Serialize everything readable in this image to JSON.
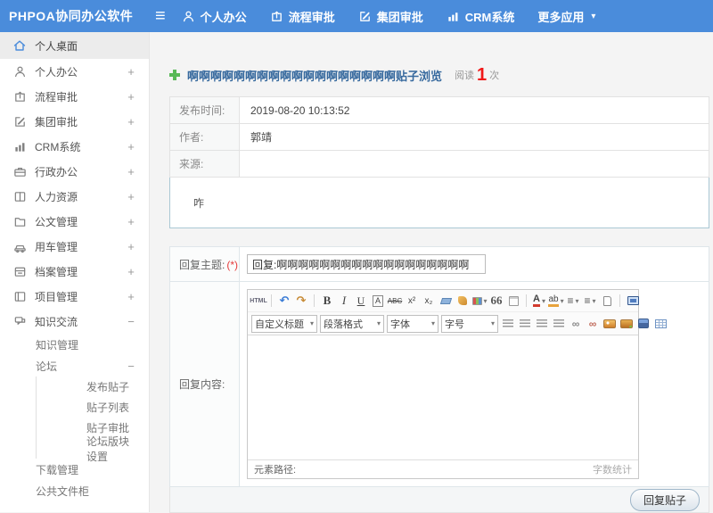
{
  "colors": {
    "accent_blue": "#4a8cdb",
    "title_blue": "#36699e",
    "alert_red": "#f01818",
    "plus_green": "#58b957"
  },
  "navbar": {
    "logo": "PHPOA协同办公软件",
    "items": [
      {
        "label": "个人办公",
        "icon": "user-icon"
      },
      {
        "label": "流程审批",
        "icon": "workflow-icon"
      },
      {
        "label": "集团审批",
        "icon": "edit-square-icon"
      },
      {
        "label": "CRM系统",
        "icon": "bar-chart-icon"
      },
      {
        "label": "更多应用",
        "icon": "caret-down-icon"
      }
    ],
    "caret": "▾",
    "hamburger": "≡"
  },
  "sidebar": {
    "items": [
      {
        "label": "个人桌面",
        "icon": "home-icon",
        "level": 0,
        "selected": true,
        "expander": ""
      },
      {
        "label": "个人办公",
        "icon": "user-icon",
        "level": 0,
        "expander": "+"
      },
      {
        "label": "流程审批",
        "icon": "workflow-icon",
        "level": 0,
        "expander": "+"
      },
      {
        "label": "集团审批",
        "icon": "edit-square-icon",
        "level": 0,
        "expander": "+"
      },
      {
        "label": "CRM系统",
        "icon": "bar-chart-icon",
        "level": 0,
        "expander": "+"
      },
      {
        "label": "行政办公",
        "icon": "briefcase-icon",
        "level": 0,
        "expander": "+"
      },
      {
        "label": "人力资源",
        "icon": "book-icon",
        "level": 0,
        "expander": "+"
      },
      {
        "label": "公文管理",
        "icon": "folder-icon",
        "level": 0,
        "expander": "+"
      },
      {
        "label": "用车管理",
        "icon": "car-icon",
        "level": 0,
        "expander": "+"
      },
      {
        "label": "档案管理",
        "icon": "archive-icon",
        "level": 0,
        "expander": "+"
      },
      {
        "label": "项目管理",
        "icon": "project-icon",
        "level": 0,
        "expander": "+"
      },
      {
        "label": "知识交流",
        "icon": "chat-icon",
        "level": 0,
        "expander": "−"
      },
      {
        "label": "知识管理",
        "level": 1,
        "expander": ""
      },
      {
        "label": "论坛",
        "level": 1,
        "expander": "−"
      },
      {
        "label": "发布贴子",
        "level": 2
      },
      {
        "label": "贴子列表",
        "level": 2
      },
      {
        "label": "贴子审批",
        "level": 2
      },
      {
        "label": "论坛版块设置",
        "level": 2
      },
      {
        "label": "下载管理",
        "level": 1
      },
      {
        "label": "公共文件柜",
        "level": 1
      }
    ]
  },
  "post": {
    "title": "啊啊啊啊啊啊啊啊啊啊啊啊啊啊啊啊啊啊贴子浏览",
    "read_label": "阅读",
    "read_count": "1",
    "read_unit": "次",
    "fields": [
      {
        "label": "发布时间:",
        "value": "2019-08-20 10:13:52"
      },
      {
        "label": "作者:",
        "value": "郭靖"
      },
      {
        "label": "来源:",
        "value": ""
      }
    ],
    "content": "咋"
  },
  "reply": {
    "subject_label": "回复主题:",
    "required_mark": "(*)",
    "subject_value": "回复:啊啊啊啊啊啊啊啊啊啊啊啊啊啊啊啊啊啊",
    "content_label": "回复内容:",
    "submit_button": "回复贴子"
  },
  "editor": {
    "icons": {
      "source": "HTML",
      "undo": "↶",
      "redo": "↷",
      "bold": "B",
      "italic": "I",
      "underline": "U",
      "boxed_a": "A",
      "strikethrough": "ABC",
      "superscript": "x²",
      "subscript": "x₂",
      "blockquote": "66",
      "font_color": "A",
      "highlight": "ab",
      "list_glyph": "≡",
      "link": "∞",
      "unlink": "∞"
    },
    "selects": [
      {
        "label": "自定义标题"
      },
      {
        "label": "段落格式"
      },
      {
        "label": "字体"
      },
      {
        "label": "字号"
      }
    ],
    "statusbar_left": "元素路径:",
    "statusbar_right": "字数统计"
  }
}
